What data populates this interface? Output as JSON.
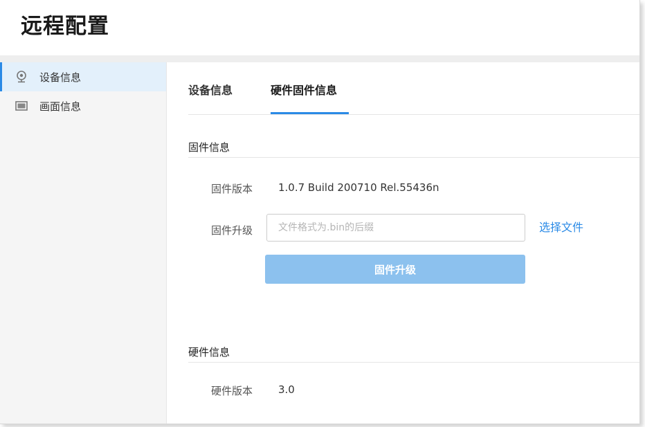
{
  "page": {
    "title": "远程配置"
  },
  "sidebar": {
    "items": [
      {
        "label": "设备信息",
        "icon": "location-pin-icon",
        "active": true
      },
      {
        "label": "画面信息",
        "icon": "monitor-icon",
        "active": false
      }
    ]
  },
  "tabs": [
    {
      "label": "设备信息",
      "active": false
    },
    {
      "label": "硬件固件信息",
      "active": true
    }
  ],
  "firmware": {
    "section_title": "固件信息",
    "version_label": "固件版本",
    "version_value": "1.0.7 Build 200710 Rel.55436n",
    "upgrade_label": "固件升级",
    "file_placeholder": "文件格式为.bin的后缀",
    "file_value": "",
    "choose_file_label": "选择文件",
    "upgrade_button_label": "固件升级"
  },
  "hardware": {
    "section_title": "硬件信息",
    "version_label": "硬件版本",
    "version_value": "3.0"
  },
  "colors": {
    "accent": "#2a8ae6",
    "button_disabled": "#8cc1ee",
    "sidebar_active_bg": "#e3f0fb",
    "sidebar_bg": "#f5f5f5"
  }
}
